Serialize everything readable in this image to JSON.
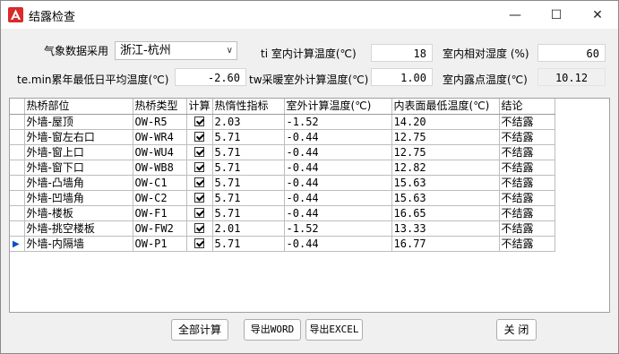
{
  "window": {
    "title": "结露检查",
    "minimize_glyph": "—",
    "maximize_glyph": "☐",
    "close_glyph": "✕"
  },
  "form": {
    "weather_label": "气象数据采用",
    "weather_value": "浙江-杭州",
    "ti_label": "ti 室内计算温度(℃)",
    "ti_value": "18",
    "rh_label": "室内相对湿度 (%)",
    "rh_value": "60",
    "temin_label": "te.min累年最低日平均温度(℃)",
    "temin_value": "-2.60",
    "tw_label": "tw采暖室外计算温度(℃)",
    "tw_value": "1.00",
    "dew_label": "室内露点温度(℃)",
    "dew_value": "10.12"
  },
  "table": {
    "headers": [
      "热桥部位",
      "热桥类型",
      "计算",
      "热惰性指标",
      "室外计算温度(℃)",
      "内表面最低温度(℃)",
      "结论"
    ],
    "rows": [
      {
        "part": "外墙-屋顶",
        "type": "OW-R5",
        "calc": true,
        "inertia": "2.03",
        "outdoor": "-1.52",
        "inner": "14.20",
        "result": "不结露"
      },
      {
        "part": "外墙-窗左右口",
        "type": "OW-WR4",
        "calc": true,
        "inertia": "5.71",
        "outdoor": "-0.44",
        "inner": "12.75",
        "result": "不结露"
      },
      {
        "part": "外墙-窗上口",
        "type": "OW-WU4",
        "calc": true,
        "inertia": "5.71",
        "outdoor": "-0.44",
        "inner": "12.75",
        "result": "不结露"
      },
      {
        "part": "外墙-窗下口",
        "type": "OW-WB8",
        "calc": true,
        "inertia": "5.71",
        "outdoor": "-0.44",
        "inner": "12.82",
        "result": "不结露"
      },
      {
        "part": "外墙-凸墙角",
        "type": "OW-C1",
        "calc": true,
        "inertia": "5.71",
        "outdoor": "-0.44",
        "inner": "15.63",
        "result": "不结露"
      },
      {
        "part": "外墙-凹墙角",
        "type": "OW-C2",
        "calc": true,
        "inertia": "5.71",
        "outdoor": "-0.44",
        "inner": "15.63",
        "result": "不结露"
      },
      {
        "part": "外墙-楼板",
        "type": "OW-F1",
        "calc": true,
        "inertia": "5.71",
        "outdoor": "-0.44",
        "inner": "16.65",
        "result": "不结露"
      },
      {
        "part": "外墙-挑空楼板",
        "type": "OW-FW2",
        "calc": true,
        "inertia": "2.01",
        "outdoor": "-1.52",
        "inner": "13.33",
        "result": "不结露"
      },
      {
        "part": "外墙-内隔墙",
        "type": "OW-P1",
        "calc": true,
        "inertia": "5.71",
        "outdoor": "-0.44",
        "inner": "16.77",
        "result": "不结露"
      }
    ],
    "current_row_index": 8
  },
  "buttons": {
    "calc_all": "全部计算",
    "export_word": "导出WORD",
    "export_excel": "导出EXCEL",
    "close": "关 闭"
  },
  "colors": {
    "accent": "#0050c8",
    "icon_red": "#d92b2b"
  }
}
